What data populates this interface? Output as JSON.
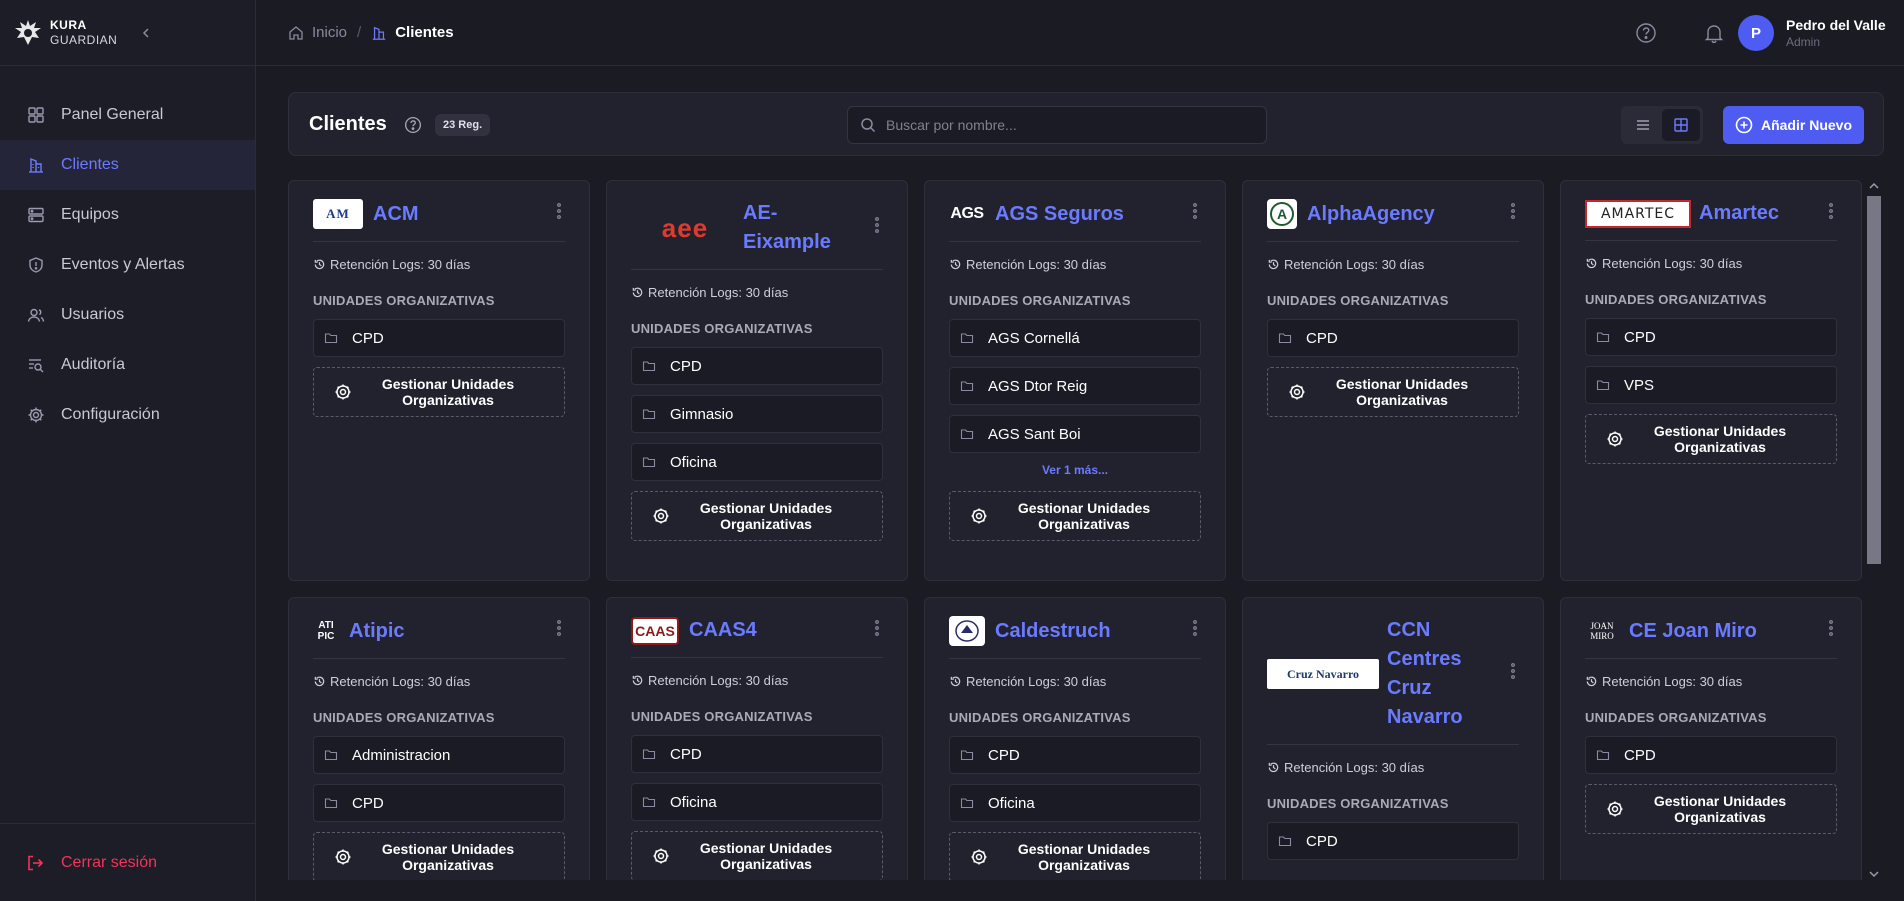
{
  "brand": {
    "line1": "KURA",
    "line2": "GUARDIAN"
  },
  "nav": [
    {
      "label": "Panel General",
      "icon": "grid-icon"
    },
    {
      "label": "Clientes",
      "icon": "building-icon",
      "active": true
    },
    {
      "label": "Equipos",
      "icon": "server-icon"
    },
    {
      "label": "Eventos y Alertas",
      "icon": "shield-icon"
    },
    {
      "label": "Usuarios",
      "icon": "users-icon"
    },
    {
      "label": "Auditoría",
      "icon": "audit-icon"
    },
    {
      "label": "Configuración",
      "icon": "gear-icon"
    }
  ],
  "logout_label": "Cerrar sesión",
  "breadcrumb": {
    "home": "Inicio",
    "separator": "/",
    "current": "Clientes"
  },
  "user": {
    "initial": "P",
    "name": "Pedro del Valle",
    "role": "Admin"
  },
  "header": {
    "title": "Clientes",
    "count_badge": "23 Reg.",
    "search_placeholder": "Buscar por nombre...",
    "add_label": "Añadir Nuevo"
  },
  "common": {
    "ou_title": "UNIDADES ORGANIZATIVAS",
    "manage_label": "Gestionar Unidades Organizativas",
    "retention": "Retención Logs: 30 días"
  },
  "colors": {
    "accent": "#4f5cf2",
    "link": "#6b7bff",
    "danger": "#f0345a",
    "background": "#1b1b24",
    "card": "#22222e"
  },
  "clients": [
    {
      "name": "ACM",
      "logo_text": "AM",
      "units": [
        "CPD"
      ]
    },
    {
      "name": "AE-Eixample",
      "logo_text": "aee",
      "units": [
        "CPD",
        "Gimnasio",
        "Oficina"
      ]
    },
    {
      "name": "AGS Seguros",
      "logo_text": "AGS",
      "units": [
        "AGS Cornellá",
        "AGS Dtor Reig",
        "AGS Sant Boi"
      ],
      "more": "Ver 1 más..."
    },
    {
      "name": "AlphaAgency",
      "logo_text": "A",
      "units": [
        "CPD"
      ]
    },
    {
      "name": "Amartec",
      "logo_text": "AMARTEC",
      "units": [
        "CPD",
        "VPS"
      ]
    },
    {
      "name": "Atipic",
      "logo_text": "ATI PIC",
      "units": [
        "Administracion",
        "CPD"
      ]
    },
    {
      "name": "CAAS4",
      "logo_text": "CAAS",
      "units": [
        "CPD",
        "Oficina"
      ]
    },
    {
      "name": "Caldestruch",
      "logo_text": "",
      "units": [
        "CPD",
        "Oficina"
      ]
    },
    {
      "name": "CCN Centres Cruz Navarro",
      "logo_text": "Cruz Navarro",
      "units": [
        "CPD"
      ]
    },
    {
      "name": "CE Joan Miro",
      "logo_text": "JOAN MIRO",
      "units": [
        "CPD"
      ]
    }
  ]
}
